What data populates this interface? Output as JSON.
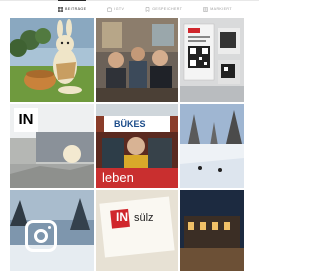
{
  "tabs": [
    {
      "label": "BEITRÄGE",
      "icon": "grid-icon",
      "active": true
    },
    {
      "label": "IGTV",
      "icon": "igtv-icon",
      "active": false
    },
    {
      "label": "GESPEICHERT",
      "icon": "bookmark-icon",
      "active": false
    },
    {
      "label": "MARKIERT",
      "icon": "tagged-icon",
      "active": false
    }
  ],
  "posts": {
    "p5_sign": "IN",
    "p6_sign": "BÜKES",
    "p6_caption": "leben",
    "p8_sign": "IN",
    "p8_sign_rest": "sülz",
    "p7_icon": "instagram-logo-icon"
  },
  "colors": {
    "active_tab": "#262626",
    "inactive_tab": "#9a9a9a",
    "brand_red": "#d0262c"
  }
}
